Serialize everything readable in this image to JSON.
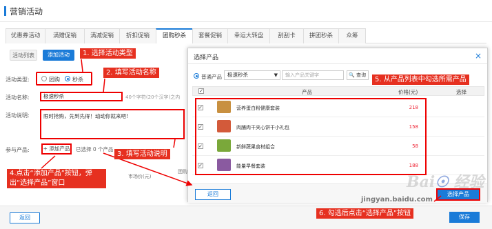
{
  "header": {
    "title": "营销活动"
  },
  "tabs": [
    {
      "label": "优惠券活动"
    },
    {
      "label": "满赠促销"
    },
    {
      "label": "满减促销"
    },
    {
      "label": "折扣促销"
    },
    {
      "label": "团购秒杀",
      "active": true
    },
    {
      "label": "套餐促销"
    },
    {
      "label": "幸运大转盘"
    },
    {
      "label": "刮刮卡"
    },
    {
      "label": "拼团秒杀"
    },
    {
      "label": "众筹"
    }
  ],
  "subtabs": {
    "list": "活动列表",
    "add": "添加活动"
  },
  "form": {
    "type_label": "活动类型:",
    "type_options": [
      "团购",
      "秒杀"
    ],
    "type_selected": "秒杀",
    "name_label": "活动名称:",
    "name_value": "极速秒杀",
    "name_hint": "40个字符(20个汉字)之内",
    "desc_label": "活动说明:",
    "desc_value": "限时抢购，先到先得！动动你就来吧!",
    "product_label": "参与产品:",
    "add_product_button": "+ 添加产品",
    "selected_count": "已选择 0 个产品"
  },
  "bg_table": {
    "col1": "团购",
    "col2": "市场价(元)"
  },
  "footer": {
    "back": "返回",
    "save": "保存"
  },
  "modal": {
    "title": "选择产品",
    "close": "×",
    "filter_radio": "普通产品",
    "select_value": "极速秒杀",
    "search_placeholder": "输入产品关键字",
    "search_button": "查询",
    "columns": {
      "product": "产品",
      "price": "价格(元)",
      "select": "选择"
    },
    "rows": [
      {
        "name": "营养蛋白粉健康套装",
        "price": "218",
        "checked": true,
        "thumb_color": "#c89040"
      },
      {
        "name": "肉脯肉干夹心饼干小礼包",
        "price": "158",
        "checked": true,
        "thumb_color": "#d35a3a"
      },
      {
        "name": "新鲜蔬果食材组合",
        "price": "58",
        "checked": true,
        "thumb_color": "#7aa83a"
      },
      {
        "name": "能量早餐套装",
        "price": "188",
        "checked": true,
        "thumb_color": "#8a5aa0"
      }
    ],
    "back_button": "返回",
    "confirm_button": "选择产品"
  },
  "annotations": [
    "1. 选择活动类型",
    "2. 填写活动名称",
    "3. 填写活动说明",
    "4.点击“添加产品”按钮，弹出“选择产品”窗口",
    "5. 从产品列表中勾选所需产品",
    "6. 勾选后点击“选择产品”按钮"
  ],
  "watermark": {
    "logo": "Bai du 经验",
    "url": "jingyan.baidu.com"
  }
}
